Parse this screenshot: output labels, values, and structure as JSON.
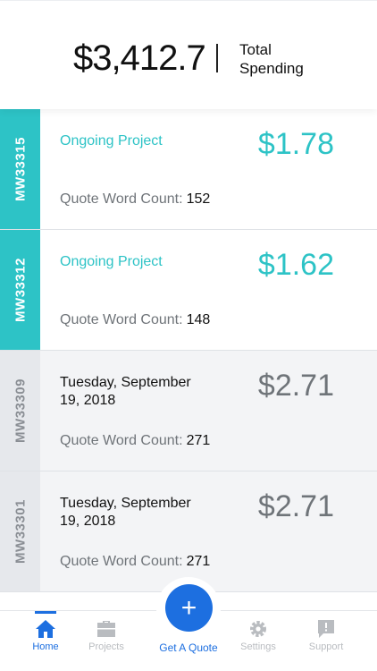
{
  "summary": {
    "amount": "$3,412.7",
    "label": "Total Spending"
  },
  "projects": [
    {
      "id": "MW33315",
      "state": "active",
      "status": "Ongoing Project",
      "price": "$1.78",
      "wc_label": "Quote Word Count:",
      "wc_value": "152"
    },
    {
      "id": "MW33312",
      "state": "active",
      "status": "Ongoing Project",
      "price": "$1.62",
      "wc_label": "Quote Word Count:",
      "wc_value": "148"
    },
    {
      "id": "MW33309",
      "state": "done",
      "status": "Tuesday, September 19, 2018",
      "price": "$2.71",
      "wc_label": "Quote Word Count:",
      "wc_value": "271"
    },
    {
      "id": "MW33301",
      "state": "done",
      "status": "Tuesday, September 19, 2018",
      "price": "$2.71",
      "wc_label": "Quote Word Count:",
      "wc_value": "271"
    }
  ],
  "nav": {
    "home": "Home",
    "projects": "Projects",
    "quote": "Get A Quote",
    "settings": "Settings",
    "support": "Support",
    "fab_symbol": "+"
  },
  "colors": {
    "accent": "#2dc3c6",
    "primary": "#1d6fe0",
    "inactive": "#b9bcc0"
  }
}
